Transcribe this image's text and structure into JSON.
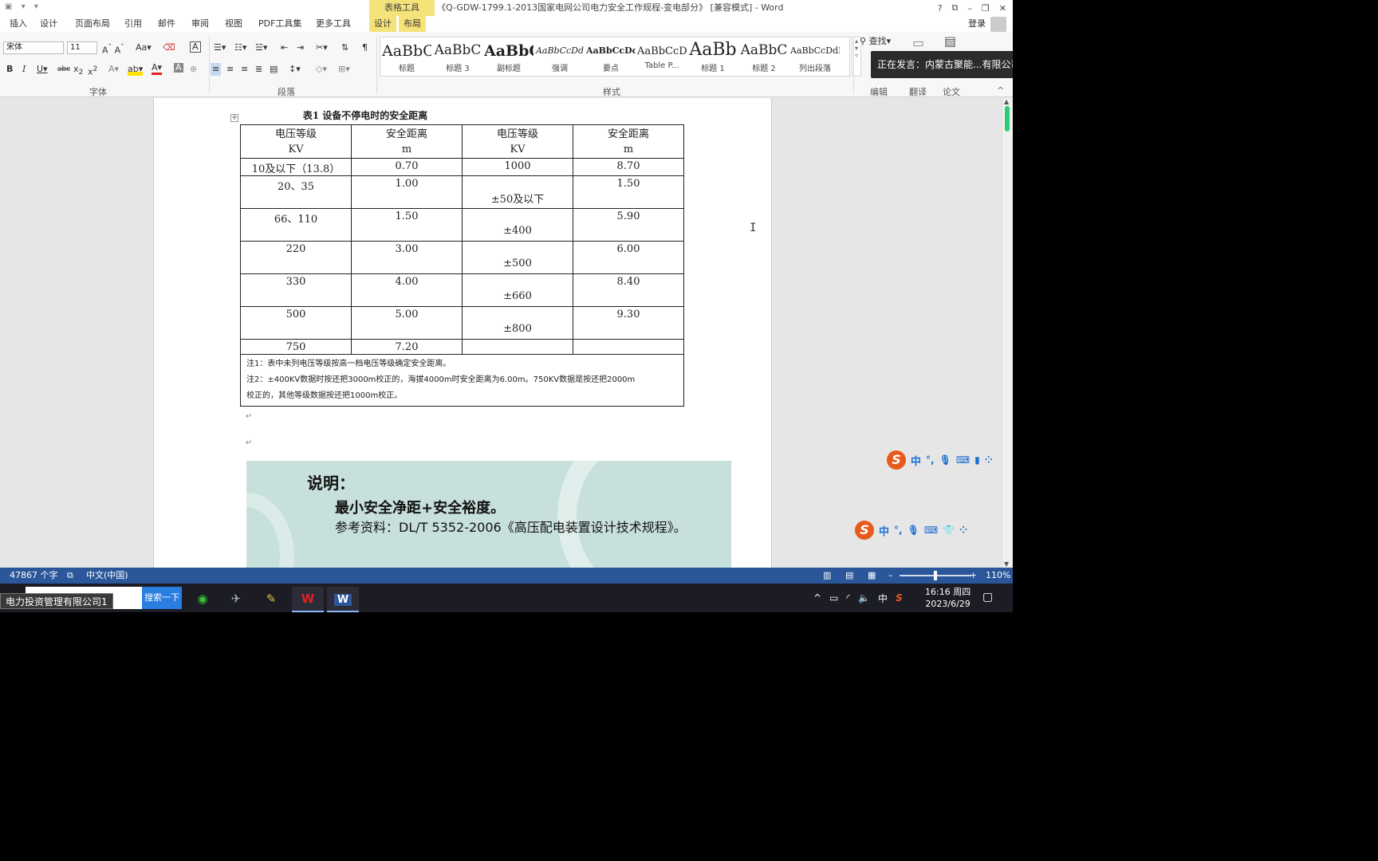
{
  "titlebar": {
    "context_tab": "表格工具",
    "title": "《Q-GDW-1799.1-2013国家电网公司电力安全工作规程-变电部分》 [兼容模式] - Word",
    "help": "?",
    "restore_ribbon": "⧉",
    "minimize": "–",
    "maximize": "❐",
    "close": "✕"
  },
  "tabs": [
    "插入",
    "设计",
    "页面布局",
    "引用",
    "邮件",
    "审阅",
    "视图",
    "PDF工具集",
    "更多工具",
    "设计",
    "布局"
  ],
  "login": "登录",
  "ribbon": {
    "font_name": "宋体",
    "font_size": "11",
    "groups": {
      "font": "字体",
      "paragraph": "段落",
      "styles": "样式",
      "edit": "编辑",
      "translate": "翻译",
      "paper": "论文"
    },
    "find": "查找",
    "styles": [
      {
        "sample": "AaBbC",
        "name": "标题"
      },
      {
        "sample": "AaBbC",
        "name": "标题 3"
      },
      {
        "sample": "AaBbC",
        "name": "副标题"
      },
      {
        "sample": "AaBbCcDd",
        "name": "强调"
      },
      {
        "sample": "AaBbCcDc",
        "name": "要点"
      },
      {
        "sample": "AaBbCcD",
        "name": "Table P..."
      },
      {
        "sample": "AaBb",
        "name": "标题 1"
      },
      {
        "sample": "AaBbC",
        "name": "标题 2"
      },
      {
        "sample": "AaBbCcDdI",
        "name": "列出段落"
      }
    ]
  },
  "speaking_tip": "正在发言：内蒙古聚能...有限公司",
  "document": {
    "table_title": "表1 设备不停电时的安全距离",
    "headers": [
      "电压等级",
      "安全距离",
      "电压等级",
      "安全距离"
    ],
    "header_units": [
      "KV",
      "m",
      "KV",
      "m"
    ],
    "rows": [
      [
        "10及以下（13.8）",
        "0.70",
        "1000",
        "8.70"
      ],
      [
        "20、35",
        "1.00",
        "±50及以下",
        "1.50"
      ],
      [
        "66、110",
        "1.50",
        "±400",
        "5.90"
      ],
      [
        "220",
        "3.00",
        "±500",
        "6.00"
      ],
      [
        "330",
        "4.00",
        "±660",
        "8.40"
      ],
      [
        "500",
        "5.00",
        "±800",
        "9.30"
      ],
      [
        "750",
        "7.20",
        "",
        ""
      ]
    ],
    "note1": "注1：表中未列电压等级按高一档电压等级确定安全距离。",
    "note2a": "注2：±400KV数据时按还把3000m校正的，海拔4000m时安全距离为6.00m。750KV数据是按还把2000m",
    "note2b": "校正的，其他等级数据按还把1000m校正。",
    "slide": {
      "heading": "说明：",
      "line1": "最小安全净距+安全裕度。",
      "line2": "参考资料：DL/T 5352-2006《高压配电装置设计技术规程》。"
    }
  },
  "ime": {
    "lang": "中"
  },
  "statusbar": {
    "words": "47867 个字",
    "language": "中文(中国)",
    "zoom": "110%",
    "zoom_level": 0.5
  },
  "taskbar": {
    "label": "电力投资管理有限公司1",
    "search_button": "搜索一下",
    "tray_lang": "中",
    "time": "16:16 周四",
    "date": "2023/6/29"
  },
  "colors": {
    "status_bar": "#2b579a",
    "context_tab": "#f5e37a",
    "slide_bg": "#c7e0dc"
  }
}
